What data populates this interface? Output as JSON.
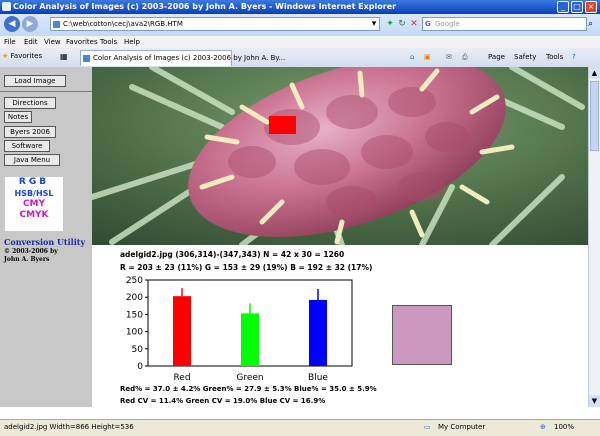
{
  "window": {
    "title": "Color Analysis of Images (c) 2003-2006 by John A. Byers - Windows Internet Explorer"
  },
  "address_bar": {
    "url": "C:\\web\\cotton\\cecj\\ava2\\RGB.HTM",
    "search_placeholder": "Google"
  },
  "menu": [
    "File",
    "Edit",
    "View",
    "Favorites",
    "Tools",
    "Help"
  ],
  "favorites_label": "Favorites",
  "tab_title": "Color Analysis of Images (c) 2003-2006 by John A. By...",
  "command_bar": {
    "page": "Page",
    "safety": "Safety",
    "tools": "Tools"
  },
  "sidebar": {
    "load_image": "Load Image",
    "directions": "Directions",
    "notes": "Notes",
    "byers": "Byers 2006",
    "software": "Software",
    "java_menu": "Java Menu",
    "logo_lines": [
      "RGB",
      "HSB/HSL",
      "CMY",
      "CMYK"
    ],
    "conversion": "Conversion Utility",
    "copyright": "© 2003-2006 by",
    "author": "John A. Byers"
  },
  "info": {
    "line1": "adelgid2.jpg    (306,314)-(347,343)    N = 42 x 30 = 1260",
    "line2": "R = 203 ± 23 (11%)   G = 153 ± 29 (19%)   B = 192 ± 32 (17%)",
    "line3": "Red% = 37.0 ± 4.2%     Green% = 27.9 ± 5.3%     Blue% = 35.0 ± 5.9%",
    "line4": "Red CV = 11.4%          Green CV = 19.0%          Blue CV = 16.9%"
  },
  "chart_data": {
    "type": "bar",
    "categories": [
      "Red",
      "Green",
      "Blue"
    ],
    "values": [
      203,
      153,
      192
    ],
    "errors": [
      23,
      29,
      32
    ],
    "colors": [
      "#ff0000",
      "#00ff00",
      "#0000ff"
    ],
    "ylim": [
      0,
      250
    ],
    "yticks": [
      0,
      50,
      100,
      150,
      200,
      250
    ],
    "xlabel": "",
    "ylabel": "",
    "title": ""
  },
  "swatch_color": "#cb99c0",
  "status_bar": {
    "left": "adelgid2.jpg  Width=866  Height=536",
    "zone": "My Computer",
    "zoom": "100%"
  }
}
